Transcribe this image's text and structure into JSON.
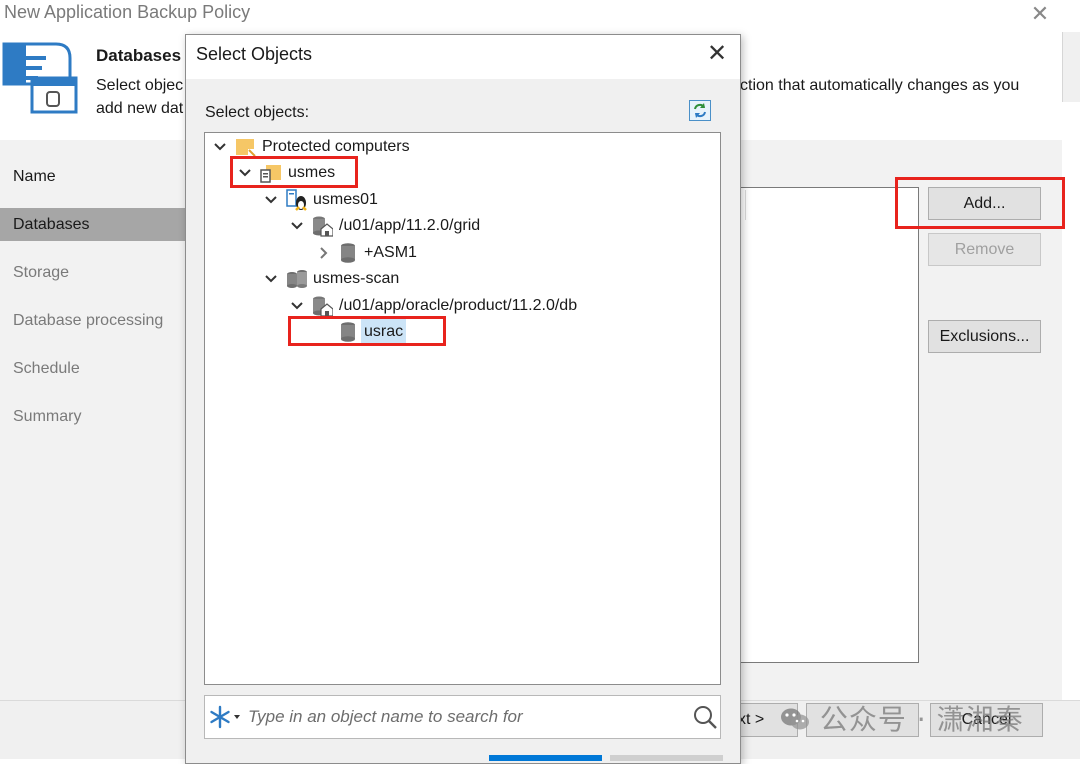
{
  "window": {
    "title": "New Application Backup Policy",
    "close_glyph": "✕"
  },
  "header": {
    "heading": "Databases",
    "description_left_line1": "Select objec",
    "description_left_line2": "add new dat",
    "description_right": "ction that automatically changes as you"
  },
  "nav": {
    "items": [
      {
        "label": "Name",
        "state": "done"
      },
      {
        "label": "Databases",
        "state": "active"
      },
      {
        "label": "Storage",
        "state": "pending"
      },
      {
        "label": "Database processing",
        "state": "pending"
      },
      {
        "label": "Schedule",
        "state": "pending"
      },
      {
        "label": "Summary",
        "state": "pending"
      }
    ]
  },
  "buttons": {
    "add": "Add...",
    "remove": "Remove",
    "exclusions": "Exclusions...",
    "next_fragment": "xt >",
    "cancel": "Cancel"
  },
  "dialog": {
    "title": "Select Objects",
    "close_glyph": "✕",
    "select_label": "Select objects:",
    "search_placeholder": "Type in an object name to search for",
    "tree": [
      {
        "label": "Protected computers",
        "icon": "folder-icon",
        "caret": "down"
      },
      {
        "label": "usmes",
        "icon": "cluster-folder-icon",
        "caret": "down"
      },
      {
        "label": "usmes01",
        "icon": "linux-server-icon",
        "caret": "down"
      },
      {
        "label": "/u01/app/11.2.0/grid",
        "icon": "oracle-home-icon",
        "caret": "down"
      },
      {
        "label": "+ASM1",
        "icon": "database-icon",
        "caret": "right"
      },
      {
        "label": "usmes-scan",
        "icon": "database-cluster-icon",
        "caret": "down"
      },
      {
        "label": "/u01/app/oracle/product/11.2.0/db",
        "icon": "oracle-home-icon",
        "caret": "down"
      },
      {
        "label": "usrac",
        "icon": "database-icon",
        "caret": "none",
        "selected": true
      }
    ]
  },
  "watermark": {
    "text": "公众号 · 潇湘秦"
  },
  "colors": {
    "highlight_red": "#e8231d",
    "selection_blue": "#cce4f7",
    "nav_active": "#a6a6a6"
  }
}
